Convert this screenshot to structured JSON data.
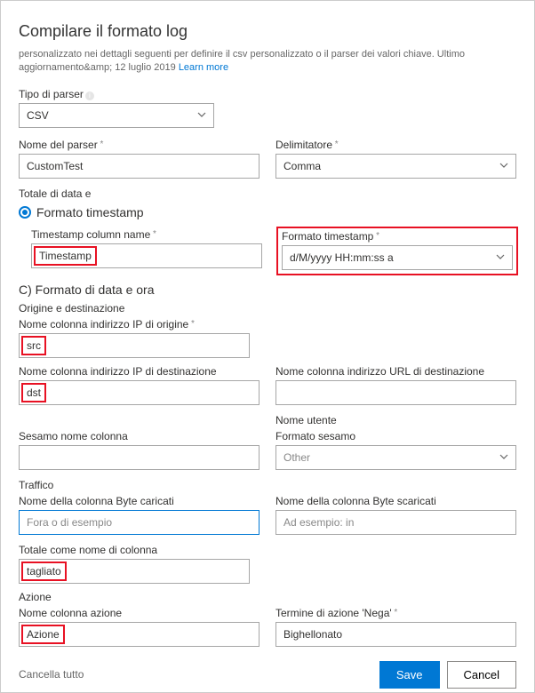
{
  "header": {
    "title": "Compilare il formato log",
    "subtitle": "personalizzato nei dettagli seguenti per definire il csv personalizzato o il parser dei valori chiave. Ultimo aggiornamento&amp; 12 luglio 2019",
    "learn_more": "Learn more"
  },
  "parser_type": {
    "label": "Tipo di parser",
    "value": "CSV"
  },
  "parser_name": {
    "label": "Nome del parser",
    "value": "CustomTest"
  },
  "delimiter": {
    "label": "Delimitatore",
    "value": "Comma"
  },
  "total_data": {
    "label": "Totale di data e",
    "radio_label": "Formato timestamp"
  },
  "ts_col": {
    "label": "Timestamp column name",
    "value": "Timestamp"
  },
  "ts_fmt": {
    "label": "Formato timestamp",
    "value": "d/M/yyyy HH:mm:ss a"
  },
  "section_c": "C) Formato di data e ora",
  "origin_dest": "Origine e destinazione",
  "src_ip": {
    "label": "Nome colonna indirizzo IP di origine",
    "value": "src"
  },
  "dst_ip": {
    "label": "Nome colonna indirizzo IP di destinazione",
    "value": "dst"
  },
  "dst_url": {
    "label": "Nome colonna indirizzo URL di destinazione",
    "value": ""
  },
  "sesame": {
    "label": "Sesamo nome colonna",
    "value": ""
  },
  "username_header": "Nome utente",
  "sesame_fmt": {
    "label": "Formato sesamo",
    "value": "Other"
  },
  "traffic": "Traffico",
  "bytes_up": {
    "label": "Nome della colonna Byte caricati",
    "placeholder": "Fora o di esempio"
  },
  "bytes_down": {
    "label": "Nome della colonna Byte scaricati",
    "placeholder": "Ad esempio: in"
  },
  "total_col": {
    "label": "Totale come nome di colonna",
    "value": "tagliato"
  },
  "action_section": "Azione",
  "action_col": {
    "label": "Nome colonna azione",
    "value": "Azione"
  },
  "deny_term": {
    "label": "Termine di azione 'Nega'",
    "value": "Bighellonato"
  },
  "footer": {
    "clear": "Cancella tutto",
    "save": "Save",
    "cancel": "Cancel"
  }
}
